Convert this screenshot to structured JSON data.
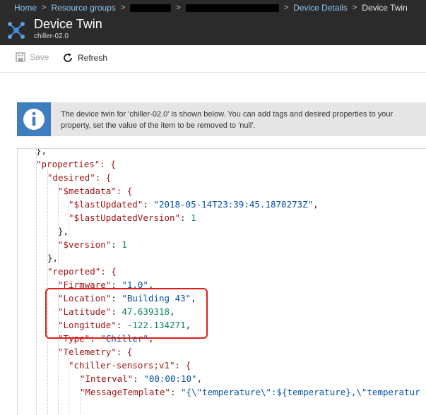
{
  "breadcrumb": {
    "home": "Home",
    "resource_groups": "Resource groups",
    "device_details": "Device Details",
    "current": "Device Twin"
  },
  "header": {
    "title": "Device Twin",
    "subtitle": "chiller-02.0"
  },
  "toolbar": {
    "save_label": "Save",
    "refresh_label": "Refresh"
  },
  "info": {
    "line1": "The device twin for 'chiller-02.0' is shown below. You can add tags and desired properties to your",
    "line2": "property, set the value of the item to be removed to 'null'."
  },
  "code": {
    "l0": "},",
    "l1": "\"properties\": {",
    "l2": "\"desired\": {",
    "l3": "\"$metadata\": {",
    "l4_key": "\"$lastUpdated\"",
    "l4_val": "\"2018-05-14T23:39:45.1870273Z\"",
    "l5_key": "\"$lastUpdatedVersion\"",
    "l5_val": "1",
    "l6": "},",
    "l7_key": "\"$version\"",
    "l7_val": "1",
    "l8": "},",
    "l9": "\"reported\": {",
    "l10_key": "\"Firmware\"",
    "l10_val": "\"1.0\"",
    "l11_key": "\"Location\"",
    "l11_val": "\"Building 43\"",
    "l12_key": "\"Latitude\"",
    "l12_val": "47.639318",
    "l13_key": "\"Longitude\"",
    "l13_val": "-122.134271",
    "l14_key": "\"Type\"",
    "l14_val": "\"Chiller\"",
    "l15": "\"Telemetry\": {",
    "l16": "\"chiller-sensors;v1\": {",
    "l17_key": "\"Interval\"",
    "l17_val": "\"00:00:10\"",
    "l18_key": "\"MessageTemplate\"",
    "l18_val": "\"{\\\"temperature\\\":${temperature},\\\"temperatur"
  }
}
